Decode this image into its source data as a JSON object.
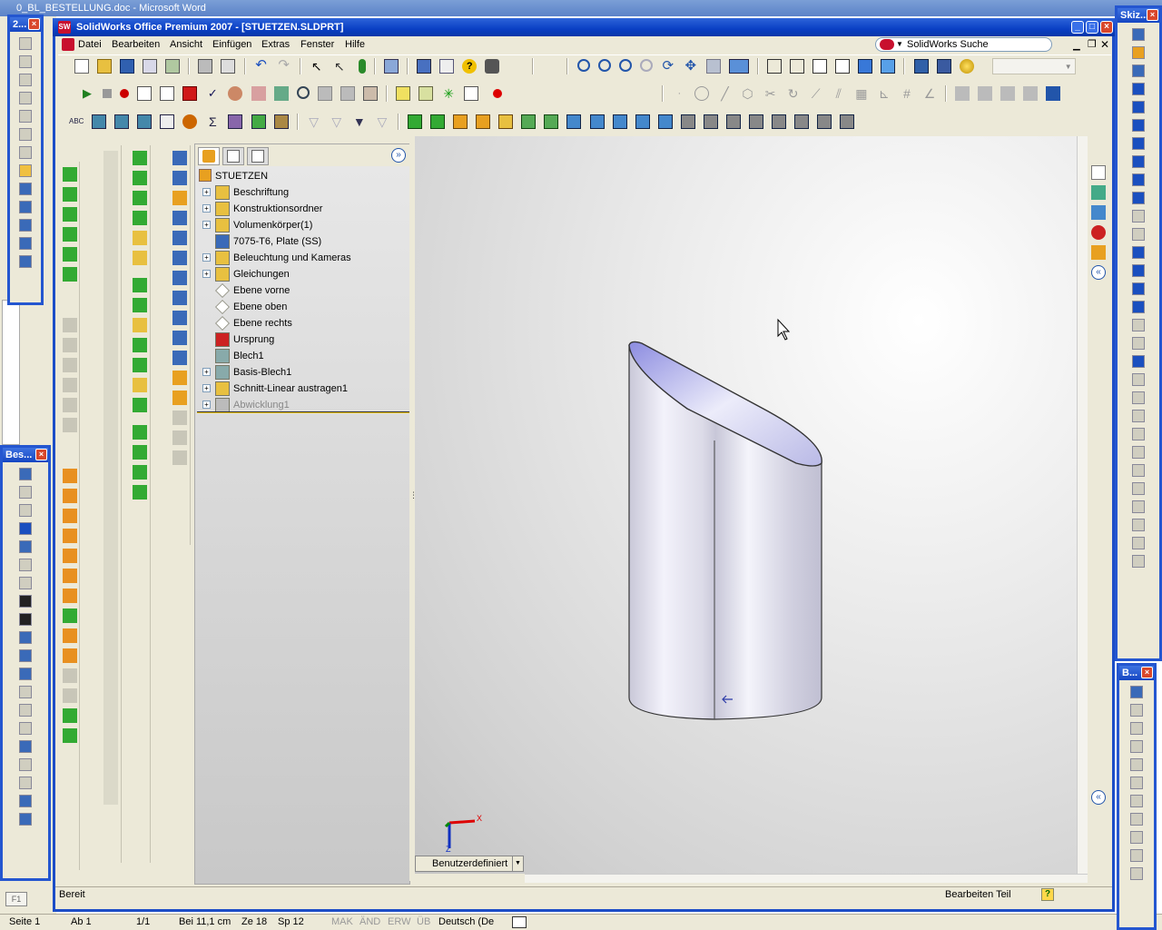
{
  "word": {
    "title": "0_BL_BESTELLUNG.doc - Microsoft Word",
    "status": [
      "Seite 1",
      "Ab 1",
      "1/1",
      "Bei 11,1 cm",
      "Ze 18",
      "Sp 12",
      "MAK",
      "ÄND",
      "ERW",
      "ÜB",
      "Deutsch (De"
    ]
  },
  "sw": {
    "title": "SolidWorks Office Premium 2007 - [STUETZEN.SLDPRT]",
    "menu": [
      "Datei",
      "Bearbeiten",
      "Ansicht",
      "Einfügen",
      "Extras",
      "Fenster",
      "Hilfe"
    ],
    "search_label": "SolidWorks Suche",
    "status_left": "Bereit",
    "status_right": "Bearbeiten Teil",
    "view_orientation": "Benutzerdefiniert",
    "tree": {
      "root": "STUETZEN",
      "items": [
        {
          "label": "Beschriftung",
          "expand": true,
          "icon": "annotation-icon"
        },
        {
          "label": "Konstruktionsordner",
          "expand": true,
          "icon": "design-folder-icon"
        },
        {
          "label": "Volumenkörper(1)",
          "expand": true,
          "icon": "solid-bodies-icon"
        },
        {
          "label": "7075-T6, Plate (SS)",
          "expand": false,
          "icon": "material-icon"
        },
        {
          "label": "Beleuchtung und Kameras",
          "expand": true,
          "icon": "lights-icon"
        },
        {
          "label": "Gleichungen",
          "expand": true,
          "icon": "equations-icon"
        },
        {
          "label": "Ebene vorne",
          "expand": false,
          "icon": "plane-icon"
        },
        {
          "label": "Ebene oben",
          "expand": false,
          "icon": "plane-icon"
        },
        {
          "label": "Ebene rechts",
          "expand": false,
          "icon": "plane-icon"
        },
        {
          "label": "Ursprung",
          "expand": false,
          "icon": "origin-icon"
        },
        {
          "label": "Blech1",
          "expand": false,
          "icon": "sheetmetal-icon"
        },
        {
          "label": "Basis-Blech1",
          "expand": true,
          "icon": "base-flange-icon"
        },
        {
          "label": "Schnitt-Linear austragen1",
          "expand": true,
          "icon": "cut-extrude-icon"
        },
        {
          "label": "Abwicklung1",
          "expand": true,
          "icon": "flatten-icon"
        }
      ]
    }
  },
  "palettes": {
    "p1": "2...",
    "p2": "Bes...",
    "p3": "Skiz...",
    "p4": "B..."
  },
  "triad": {
    "x": "X",
    "y": "Y",
    "z": "Z"
  },
  "word_help": "F1"
}
